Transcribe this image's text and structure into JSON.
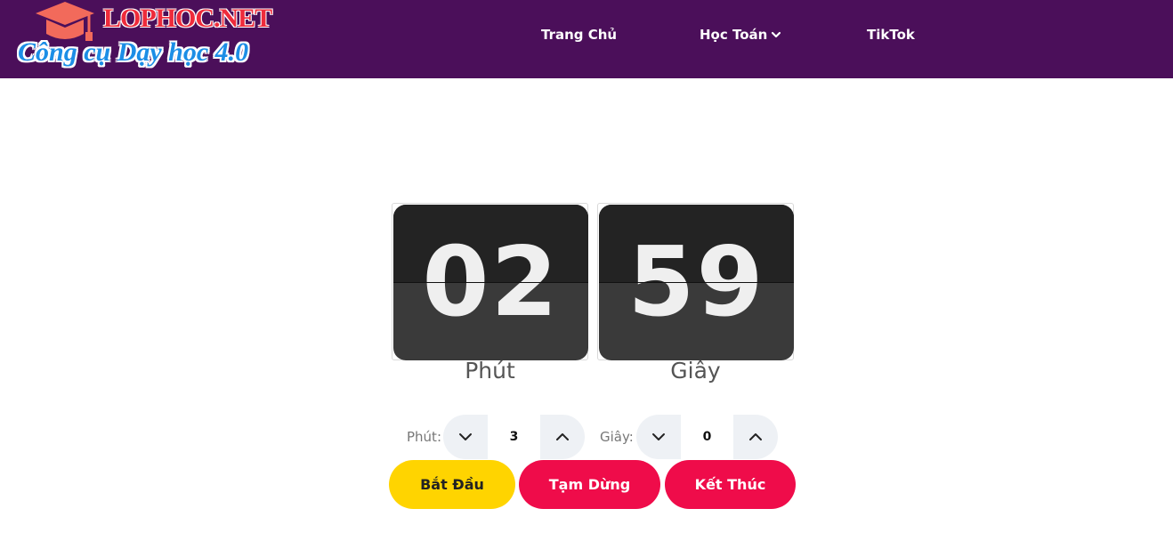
{
  "header": {
    "logo": {
      "site_name": "LOPHOC.NET",
      "slogan": "Công cụ Dạy học 4.0",
      "icon": "graduation-cap-icon",
      "cap_color": "#f26a5b"
    },
    "nav": {
      "home": "Trang Chủ",
      "math": "Học Toán",
      "math_icon": "chevron-down-icon",
      "tiktok": "TikTok"
    },
    "background": "#4b0f5a"
  },
  "timer": {
    "minutes_display": "02",
    "seconds_display": "59",
    "minutes_label": "Phút",
    "seconds_label": "Giây"
  },
  "settings": {
    "minutes": {
      "label": "Phút:",
      "value": "3",
      "decrement_icon": "chevron-down-icon",
      "increment_icon": "chevron-up-icon"
    },
    "seconds": {
      "label": "Giây:",
      "value": "0",
      "decrement_icon": "chevron-down-icon",
      "increment_icon": "chevron-up-icon"
    }
  },
  "actions": {
    "start": "Bắt Đầu",
    "pause": "Tạm Dừng",
    "stop": "Kết Thúc",
    "start_color": "#ffd400",
    "danger_color": "#ef0c4a"
  }
}
